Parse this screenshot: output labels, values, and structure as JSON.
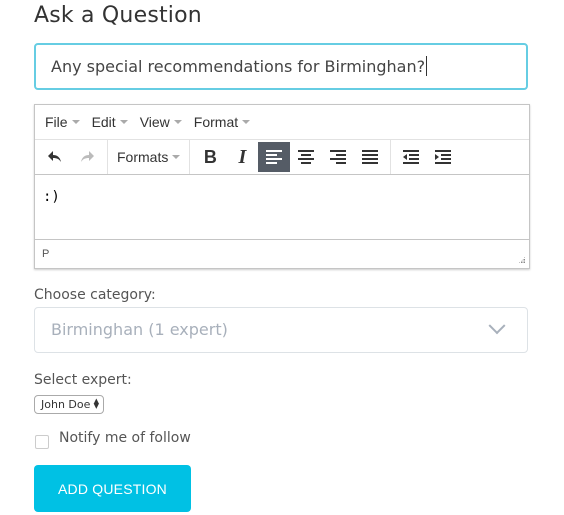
{
  "page": {
    "title": "Ask a Question"
  },
  "question_input": {
    "value": "Any special recommendations for Birminghan?"
  },
  "editor": {
    "menubar": [
      {
        "label": "File"
      },
      {
        "label": "Edit"
      },
      {
        "label": "View"
      },
      {
        "label": "Format"
      }
    ],
    "toolbar": {
      "formats_label": "Formats",
      "bold_label": "B",
      "italic_label": "I",
      "active_button": "align-left"
    },
    "content": ":)",
    "status_path": "P"
  },
  "category": {
    "label": "Choose category:",
    "selected": "Birminghan (1 expert)"
  },
  "expert": {
    "label": "Select expert:",
    "selected": "John Doe"
  },
  "notify": {
    "label": "Notify me of follow",
    "checked": false
  },
  "submit": {
    "label": "ADD QUESTION"
  },
  "colors": {
    "accent": "#00c1e4",
    "input_focus_border": "#66cde3",
    "active_toolbar_button": "#555c66"
  }
}
